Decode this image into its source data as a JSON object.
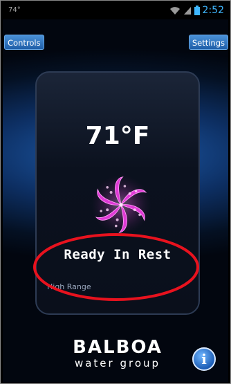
{
  "status_bar": {
    "temp": "74°",
    "time": "2:52"
  },
  "nav": {
    "controls_label": "Controls",
    "settings_label": "Settings"
  },
  "panel": {
    "temperature": "71°F",
    "state_text": "Ready In Rest",
    "range_text": "High Range"
  },
  "brand": {
    "name": "BALBOA",
    "tagline": "water group"
  },
  "info_button": {
    "glyph": "i"
  },
  "icons": {
    "pinwheel": "heater-pinwheel-icon",
    "wifi": "wifi-icon",
    "signal": "signal-icon",
    "battery": "battery-icon"
  },
  "colors": {
    "accent": "#3fb7ff",
    "pinwheel": "#e03ad6",
    "annotation": "#e8121e"
  }
}
